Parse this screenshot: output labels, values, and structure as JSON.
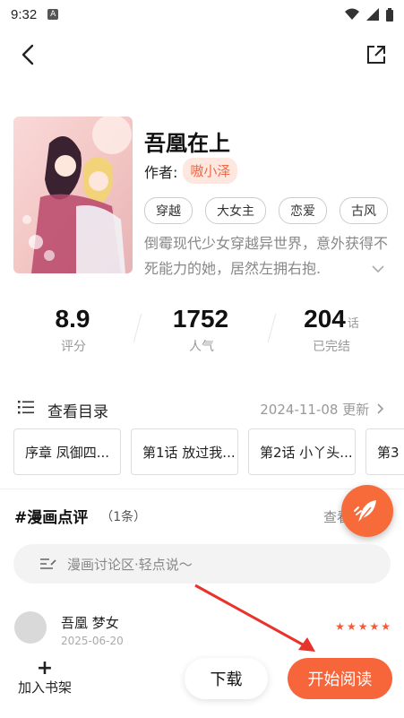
{
  "status_bar": {
    "time": "9:32",
    "notification": "A"
  },
  "book": {
    "title": "吾凰在上",
    "author_label": "作者:",
    "author_name": "嗷小泽",
    "tags": [
      "穿越",
      "大女主",
      "恋爱",
      "古风"
    ],
    "description": "倒霉现代少女穿越异世界，意外获得不死能力的她，居然左拥右抱."
  },
  "stats": [
    {
      "value": "8.9",
      "unit": "",
      "label": "评分"
    },
    {
      "value": "1752",
      "unit": "",
      "label": "人气"
    },
    {
      "value": "204",
      "unit": "话",
      "label": "已完结"
    }
  ],
  "catalog": {
    "title": "查看目录",
    "update_text": "2024-11-08 更新"
  },
  "chapters": [
    "序章 凤御四...",
    "第1话 放过我...",
    "第2话 小丫头...",
    "第3"
  ],
  "reviews": {
    "title": "#漫画点评",
    "count": "（1条）",
    "more": "查看",
    "input_placeholder": "漫画讨论区·轻点说～",
    "items": [
      {
        "name": "吾凰 梦女",
        "date": "2025-06-20",
        "rating": 5
      }
    ]
  },
  "bottom": {
    "shelf_label": "加入书架",
    "download_label": "下载",
    "read_label": "开始阅读"
  },
  "colors": {
    "accent": "#f7653a",
    "tag_bg": "#fde7df"
  }
}
